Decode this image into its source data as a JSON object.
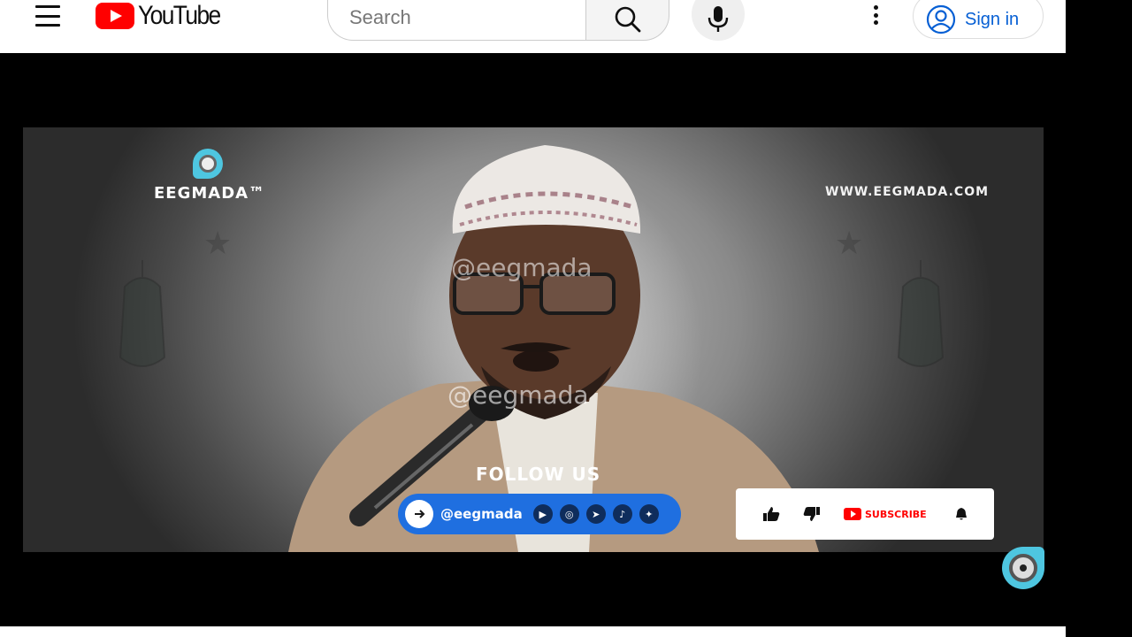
{
  "header": {
    "logo_text": "YouTube",
    "search_placeholder": "Search",
    "sign_in_label": "Sign in"
  },
  "video": {
    "brand_name": "EEGMADA™",
    "site_url": "WWW.EEGMADA.COM",
    "watermark_top": "@eegmada",
    "watermark_bottom": "@eegmada",
    "follow_label": "FOLLOW US",
    "follow_handle": "@eegmada",
    "subscribe_label": "SUBSCRIBE",
    "accent_color": "#1f6fe0",
    "social_icons": [
      "youtube-icon",
      "instagram-icon",
      "telegram-icon",
      "tiktok-icon",
      "twitter-icon"
    ]
  }
}
